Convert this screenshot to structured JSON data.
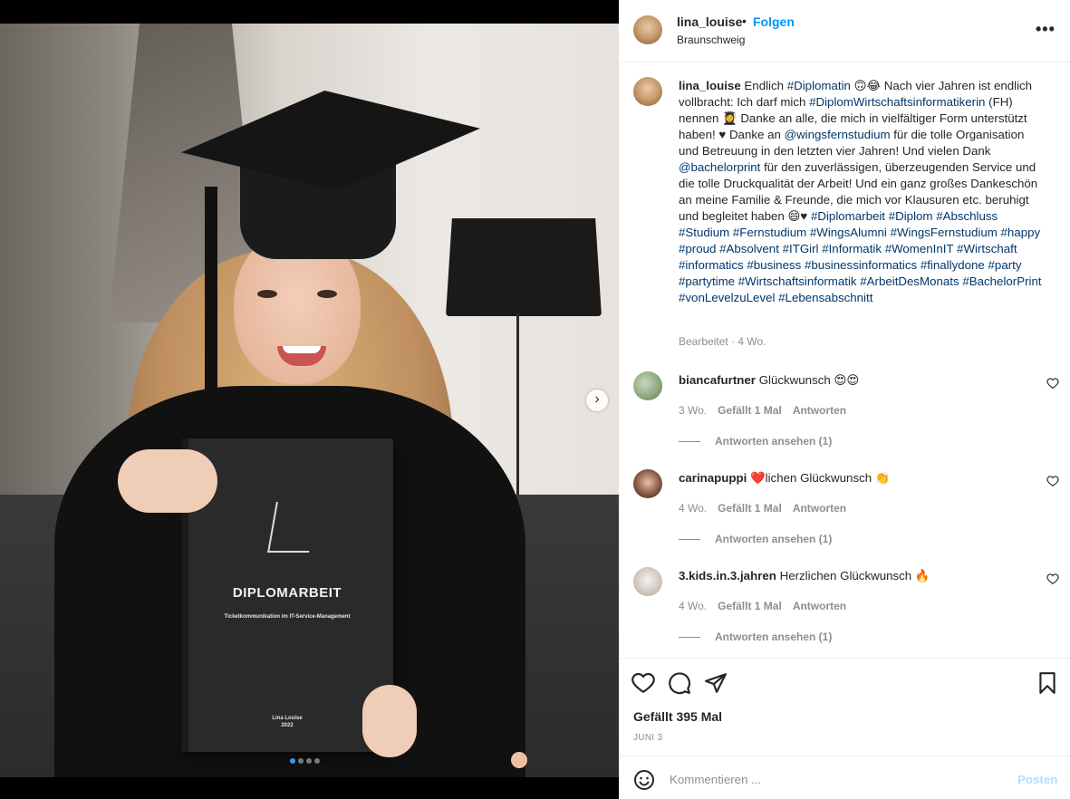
{
  "post": {
    "username": "lina_louise",
    "separator": "•",
    "follow_label": "Folgen",
    "location": "Braunschweig",
    "more_label": "•••"
  },
  "photo": {
    "book_title": "DIPLOMARBEIT",
    "book_subtitle": "Ticketkommunikation im IT-Service-Management",
    "book_author": "Lina Louise",
    "book_year": "2022",
    "next_label": "›",
    "carousel_count": 4,
    "carousel_active": 1
  },
  "caption": {
    "username": "lina_louise",
    "parts": [
      {
        "t": " Endlich "
      },
      {
        "tag": "#Diplomatin"
      },
      {
        "t": " 🙃😂 Nach vier Jahren ist endlich vollbracht: Ich darf mich "
      },
      {
        "tag": "#DiplomWirtschaftsinformatikerin"
      },
      {
        "t": " (FH) nennen 👩‍🎓 Danke an alle, die mich in vielfältiger Form unterstützt haben! ♥ Danke an "
      },
      {
        "tag": "@wingsfernstudium"
      },
      {
        "t": " für die tolle Organisation und Betreuung in den letzten vier Jahren! Und vielen Dank "
      },
      {
        "tag": "@bachelorprint"
      },
      {
        "t": " für den zuverlässigen, überzeugenden Service und die tolle Druckqualität der Arbeit! Und ein ganz großes Dankeschön an meine Familie & Freunde, die mich vor Klausuren etc. beruhigt und begleitet haben 😄♥ "
      },
      {
        "tag": "#Diplomarbeit"
      },
      {
        "t": " "
      },
      {
        "tag": "#Diplom"
      },
      {
        "t": " "
      },
      {
        "tag": "#Abschluss"
      },
      {
        "t": " "
      },
      {
        "tag": "#Studium"
      },
      {
        "t": " "
      },
      {
        "tag": "#Fernstudium"
      },
      {
        "t": " "
      },
      {
        "tag": "#WingsAlumni"
      },
      {
        "t": " "
      },
      {
        "tag": "#WingsFernstudium"
      },
      {
        "t": " "
      },
      {
        "tag": "#happy"
      },
      {
        "t": " "
      },
      {
        "tag": "#proud"
      },
      {
        "t": " "
      },
      {
        "tag": "#Absolvent"
      },
      {
        "t": " "
      },
      {
        "tag": "#ITGirl"
      },
      {
        "t": " "
      },
      {
        "tag": "#Informatik"
      },
      {
        "t": " "
      },
      {
        "tag": "#WomenInIT"
      },
      {
        "t": " "
      },
      {
        "tag": "#Wirtschaft"
      },
      {
        "t": " "
      },
      {
        "tag": "#informatics"
      },
      {
        "t": " "
      },
      {
        "tag": "#business"
      },
      {
        "t": " "
      },
      {
        "tag": "#businessinformatics"
      },
      {
        "t": " "
      },
      {
        "tag": "#finallydone"
      },
      {
        "t": " "
      },
      {
        "tag": "#party"
      },
      {
        "t": " "
      },
      {
        "tag": "#partytime"
      },
      {
        "t": " "
      },
      {
        "tag": "#Wirtschaftsinformatik"
      },
      {
        "t": " "
      },
      {
        "tag": "#ArbeitDesMonats"
      },
      {
        "t": " "
      },
      {
        "tag": "#BachelorPrint"
      },
      {
        "t": " "
      },
      {
        "tag": "#vonLevelzuLevel"
      },
      {
        "t": " "
      },
      {
        "tag": "#Lebensabschnitt"
      }
    ],
    "meta": "Bearbeitet · 4 Wo."
  },
  "comments": [
    {
      "username": "biancafurtner",
      "text": "Glückwunsch 😍😍",
      "time": "3 Wo.",
      "likes": "Gefällt 1 Mal",
      "reply": "Antworten",
      "view_replies": "Antworten ansehen (1)"
    },
    {
      "username": "carinapuppi",
      "text": "❤️lichen Glückwunsch 👏",
      "time": "4 Wo.",
      "likes": "Gefällt 1 Mal",
      "reply": "Antworten",
      "view_replies": "Antworten ansehen (1)"
    },
    {
      "username": "3.kids.in.3.jahren",
      "text": "Herzlichen Glückwunsch 🔥",
      "time": "4 Wo.",
      "likes": "Gefällt 1 Mal",
      "reply": "Antworten",
      "view_replies": "Antworten ansehen (1)"
    }
  ],
  "actions": {
    "likes": "Gefällt 395 Mal",
    "date": "JUNI 3"
  },
  "comment_bar": {
    "placeholder": "Kommentieren ...",
    "post_label": "Posten"
  },
  "colors": {
    "link": "#00376b",
    "follow": "#0095f6",
    "muted": "#8e8e8e",
    "post_disabled": "#b2dffc"
  }
}
